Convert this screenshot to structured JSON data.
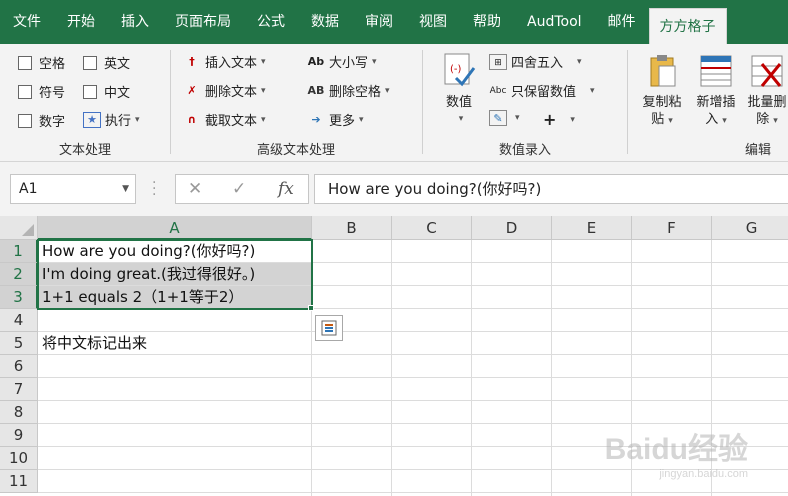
{
  "tabs": [
    "文件",
    "开始",
    "插入",
    "页面布局",
    "公式",
    "数据",
    "审阅",
    "视图",
    "帮助",
    "AudTool",
    "邮件",
    "方方格子"
  ],
  "active_tab": "方方格子",
  "ribbon": {
    "text_group": {
      "label": "文本处理",
      "items": [
        "空格",
        "英文",
        "符号",
        "中文",
        "数字",
        "执行"
      ]
    },
    "advanced_group": {
      "label": "高级文本处理",
      "col1": [
        "插入文本",
        "删除文本",
        "截取文本"
      ],
      "col2": [
        "大小写",
        "删除空格",
        "更多"
      ]
    },
    "number_group": {
      "label": "数值录入",
      "big": "数值",
      "items": [
        "四舍五入",
        "只保留数值"
      ],
      "plus": "+"
    },
    "edit_group": {
      "label": "编辑",
      "btn1": [
        "复制粘",
        "贴"
      ],
      "btn2": [
        "新增插",
        "入"
      ],
      "btn3": [
        "批量删",
        "除"
      ]
    }
  },
  "formula_bar": {
    "name_box": "A1",
    "cancel": "✕",
    "confirm": "✓",
    "fx": "fx",
    "content": "How are you doing?(你好吗?)"
  },
  "columns": [
    "A",
    "B",
    "C",
    "D",
    "E",
    "F",
    "G"
  ],
  "rows": [
    "1",
    "2",
    "3",
    "4",
    "5",
    "6",
    "7",
    "8",
    "9",
    "10",
    "11"
  ],
  "cells": {
    "A1": "How are you doing?(你好吗?)",
    "A2": "I'm doing great.(我过得很好。)",
    "A3": "1+1 equals 2（1+1等于2）",
    "A5": "将中文标记出来"
  },
  "watermark": {
    "main": "Baidu经验",
    "sub": "jingyan.baidu.com"
  }
}
